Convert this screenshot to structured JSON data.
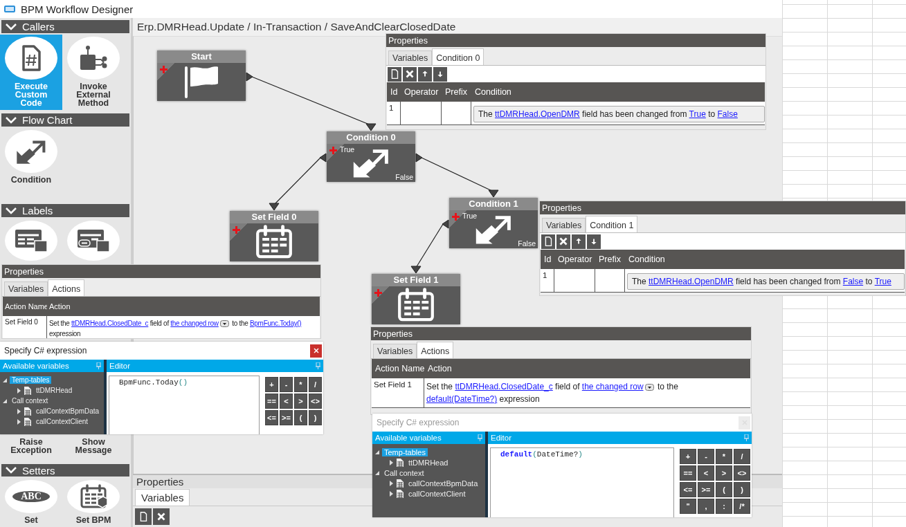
{
  "window": {
    "title": "BPM Workflow Designer"
  },
  "palette": [
    {
      "title": "Callers",
      "items": [
        {
          "label": "Execute Custom Code",
          "kind": "code",
          "selected": true
        },
        {
          "label": "Invoke External Method",
          "kind": "method",
          "selected": false
        }
      ]
    },
    {
      "title": "Flow Chart",
      "items": [
        {
          "label": "Condition",
          "kind": "condition",
          "selected": false
        }
      ]
    },
    {
      "title": "Labels",
      "items": [
        {
          "kind": "label-table",
          "selected": false
        },
        {
          "kind": "label-remove",
          "selected": false
        }
      ]
    },
    {
      "items": [
        {
          "label": "Raise Exception",
          "selected": false
        },
        {
          "label": "Show Message",
          "selected": false
        }
      ]
    },
    {
      "title": "Setters",
      "items": [
        {
          "label": "Set",
          "kind": "text",
          "badge": "ABC",
          "selected": false
        },
        {
          "label": "Set BPM",
          "kind": "calendar-box",
          "selected": false
        }
      ]
    }
  ],
  "breadcrumb": "Erp.DMRHead.Update / In-Transaction / SaveAndClearClosedDate",
  "flow": [
    {
      "title": "Start",
      "kind": "start",
      "children": [
        {
          "title": "Condition 0",
          "kind": "condition",
          "true_label": "True",
          "false_label": "False",
          "children": [
            {
              "title": "Set Field 0",
              "kind": "set-field"
            },
            {
              "title": "Condition 1",
              "kind": "condition",
              "true_label": "True",
              "false_label": "False",
              "children": [
                {
                  "title": "Set Field 1",
                  "kind": "set-field"
                }
              ]
            }
          ]
        }
      ]
    }
  ],
  "properties": {
    "title": "Properties",
    "tabs": [
      {
        "label": "Variables",
        "selected": true
      }
    ]
  },
  "panels": [
    {
      "kind": "conditions",
      "title": "Properties",
      "tabs": [
        {
          "label": "Variables",
          "selected": false
        },
        {
          "label": "Condition 0",
          "selected": true
        }
      ],
      "columns": [
        "Id",
        "Operator",
        "Prefix",
        "Condition"
      ],
      "rows": [
        {
          "id": "1",
          "condition": [
            {
              "text": "The "
            },
            {
              "text": "ttDMRHead.OpenDMR",
              "link": true
            },
            {
              "text": " field has been changed from "
            },
            {
              "text": "True",
              "link": true
            },
            {
              "text": " to "
            },
            {
              "text": "False",
              "link": true
            }
          ]
        }
      ]
    },
    {
      "kind": "conditions",
      "title": "Properties",
      "tabs": [
        {
          "label": "Variables",
          "selected": false
        },
        {
          "label": "Condition 1",
          "selected": true
        }
      ],
      "columns": [
        "Id",
        "Operator",
        "Prefix",
        "Condition"
      ],
      "rows": [
        {
          "id": "1",
          "condition": [
            {
              "text": "The "
            },
            {
              "text": "ttDMRHead.OpenDMR",
              "link": true
            },
            {
              "text": " field has been changed from "
            },
            {
              "text": "False",
              "link": true
            },
            {
              "text": " to "
            },
            {
              "text": "True",
              "link": true
            }
          ]
        }
      ]
    },
    {
      "kind": "actions",
      "title": "Properties",
      "tabs": [
        {
          "label": "Variables",
          "selected": false
        },
        {
          "label": "Actions",
          "selected": true
        }
      ],
      "columns": [
        "Action Name",
        "Action"
      ],
      "rows": [
        {
          "name": "Set Field 0",
          "action": [
            {
              "text": "Set the "
            },
            {
              "text": "ttDMRHead.ClosedDate_c",
              "link": true
            },
            {
              "text": " field of "
            },
            {
              "text": "the changed row",
              "link": true,
              "dropdown": true
            },
            {
              "text": " to the "
            },
            {
              "text": "BpmFunc.Today()",
              "link": true
            },
            {
              "text": " expression"
            }
          ]
        }
      ]
    },
    {
      "kind": "expression",
      "title": "Specify C# expression",
      "active": true,
      "variables_title": "Available variables",
      "editor_title": "Editor",
      "tree": [
        {
          "label": "Temp-tables",
          "selected": true,
          "expanded": true,
          "children": [
            {
              "label": "ttDMRHead",
              "selected": false,
              "expanded": false
            }
          ]
        },
        {
          "label": "Call context",
          "selected": false,
          "expanded": true,
          "children": [
            {
              "label": "callContextBpmData",
              "selected": false,
              "expanded": false
            },
            {
              "label": "callContextClient",
              "selected": false,
              "expanded": false
            }
          ]
        }
      ],
      "code": [
        {
          "text": "BpmFunc.Today",
          "kind": "name"
        },
        {
          "text": "()",
          "kind": "punct"
        }
      ],
      "keys": [
        "+",
        "-",
        "*",
        "/",
        "==",
        "<",
        ">",
        "<>",
        "<=",
        ">=",
        "(",
        ")"
      ]
    },
    {
      "kind": "actions",
      "title": "Properties",
      "tabs": [
        {
          "label": "Variables",
          "selected": false
        },
        {
          "label": "Actions",
          "selected": true
        }
      ],
      "columns": [
        "Action Name",
        "Action"
      ],
      "rows": [
        {
          "name": "Set Field 1",
          "action": [
            {
              "text": "Set the "
            },
            {
              "text": "ttDMRHead.ClosedDate_c",
              "link": true
            },
            {
              "text": " field of "
            },
            {
              "text": "the changed row",
              "link": true,
              "dropdown": true
            },
            {
              "text": " to the "
            },
            {
              "text": "default(DateTime?)",
              "link": true
            },
            {
              "text": " expression"
            }
          ]
        }
      ]
    },
    {
      "kind": "expression",
      "title": "Specify C# expression",
      "active": false,
      "variables_title": "Available variables",
      "editor_title": "Editor",
      "tree": [
        {
          "label": "Temp-tables",
          "selected": true,
          "expanded": true,
          "children": [
            {
              "label": "ttDMRHead",
              "selected": false,
              "expanded": false
            }
          ]
        },
        {
          "label": "Call context",
          "selected": false,
          "expanded": true,
          "children": [
            {
              "label": "callContextBpmData",
              "selected": false,
              "expanded": false
            },
            {
              "label": "callContextClient",
              "selected": false,
              "expanded": false
            }
          ]
        }
      ],
      "code": [
        {
          "text": "default",
          "kind": "keyword"
        },
        {
          "text": "(",
          "kind": "punct"
        },
        {
          "text": "DateTime?",
          "kind": "name"
        },
        {
          "text": ")",
          "kind": "punct"
        }
      ],
      "keys": [
        "+",
        "-",
        "*",
        "/",
        "==",
        "<",
        ">",
        "<>",
        "<=",
        ">=",
        "(",
        ")",
        "\"",
        ",",
        ":",
        "/*"
      ]
    }
  ]
}
